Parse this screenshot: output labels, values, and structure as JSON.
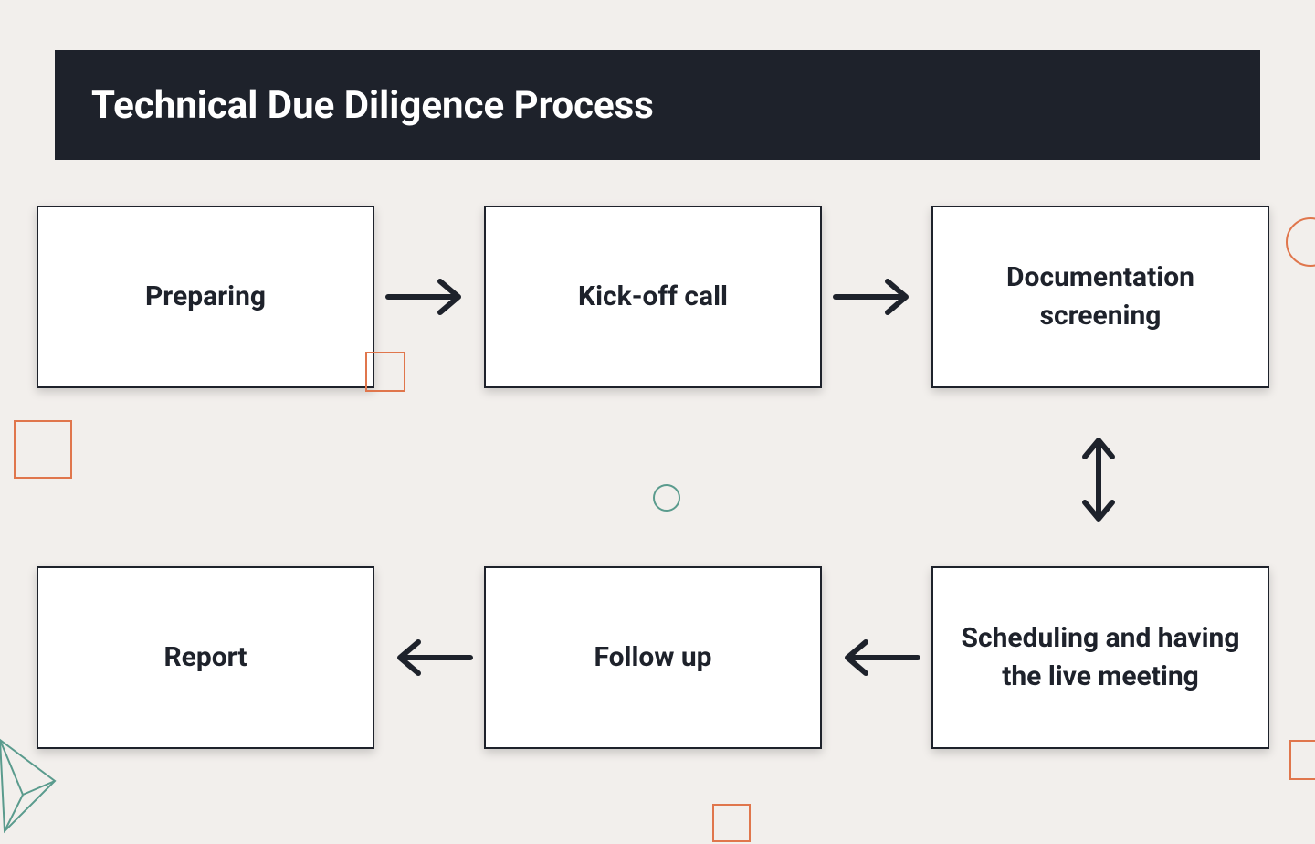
{
  "title": "Technical Due Diligence Process",
  "steps": {
    "preparing": "Preparing",
    "kickoff": "Kick-off call",
    "docscreen": "Documentation screening",
    "scheduling": "Scheduling and having the live meeting",
    "followup": "Follow up",
    "report": "Report"
  },
  "colors": {
    "titleBg": "#1e222b",
    "boxBorder": "#1e222b",
    "pageBg": "#f2efec",
    "accentOrange": "#e0764c",
    "accentTeal": "#5a9b8d"
  }
}
